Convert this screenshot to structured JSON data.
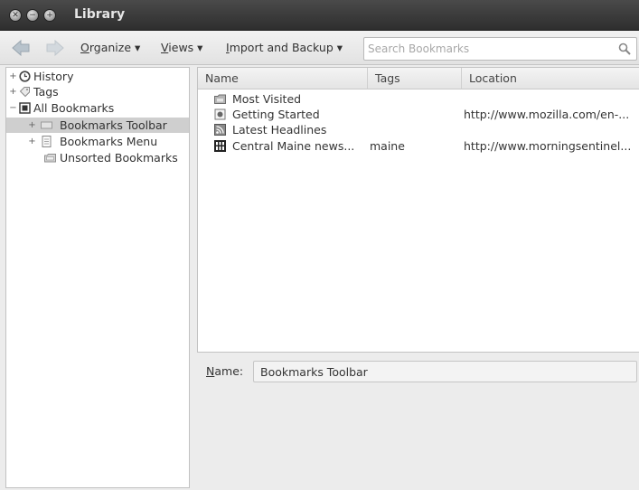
{
  "window": {
    "title": "Library"
  },
  "toolbar": {
    "organize_accel": "O",
    "organize_rest": "rganize ▾",
    "views_accel": "V",
    "views_rest": "iews ▾",
    "import_accel": "I",
    "import_rest": "mport and Backup ▾",
    "search_placeholder": "Search Bookmarks"
  },
  "sidebar": {
    "items": [
      {
        "label": "History",
        "expander": "+",
        "icon": "clock-icon"
      },
      {
        "label": "Tags",
        "expander": "+",
        "icon": "tag-icon"
      },
      {
        "label": "All Bookmarks",
        "expander": "−",
        "icon": "bookmarks-folder-icon"
      },
      {
        "label": "Bookmarks Toolbar",
        "expander": "+",
        "icon": "toolbar-folder-icon",
        "selected": true
      },
      {
        "label": "Bookmarks Menu",
        "expander": "+",
        "icon": "menu-folder-icon"
      },
      {
        "label": "Unsorted Bookmarks",
        "expander": "",
        "icon": "unsorted-folder-icon"
      }
    ]
  },
  "list": {
    "columns": [
      "Name",
      "Tags",
      "Location"
    ],
    "rows": [
      {
        "name": "Most Visited",
        "tags": "",
        "location": "",
        "icon": "smart-folder-icon"
      },
      {
        "name": "Getting Started",
        "tags": "",
        "location": "http://www.mozilla.com/en-...",
        "icon": "page-icon"
      },
      {
        "name": "Latest Headlines",
        "tags": "",
        "location": "",
        "icon": "feed-icon"
      },
      {
        "name": "Central Maine news...",
        "tags": "maine",
        "location": "http://www.morningsentinel...",
        "icon": "site-favicon-icon"
      }
    ]
  },
  "details": {
    "name_accel": "N",
    "name_rest": "ame:",
    "name_value": "Bookmarks Toolbar"
  },
  "colors": {
    "titlebar": "#3a3a3a",
    "selection": "#cfcfcf"
  }
}
